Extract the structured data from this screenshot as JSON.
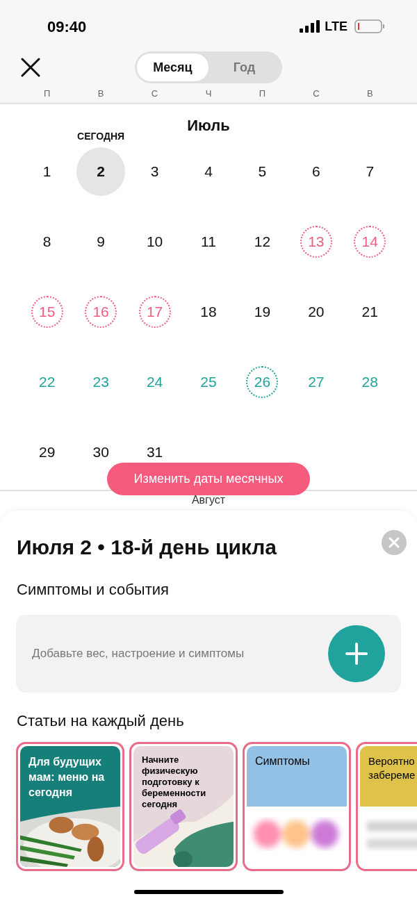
{
  "status_bar": {
    "time": "09:40",
    "network": "LTE"
  },
  "header": {
    "tabs": [
      {
        "label": "Месяц",
        "selected": true
      },
      {
        "label": "Год",
        "selected": false
      }
    ]
  },
  "weekdays": [
    "П",
    "В",
    "С",
    "Ч",
    "П",
    "С",
    "В"
  ],
  "month": {
    "title": "Июль",
    "today_label": "СЕГОДНЯ",
    "days": [
      {
        "label": "1",
        "kind": "normal"
      },
      {
        "label": "2",
        "kind": "today"
      },
      {
        "label": "3",
        "kind": "normal"
      },
      {
        "label": "4",
        "kind": "normal"
      },
      {
        "label": "5",
        "kind": "normal"
      },
      {
        "label": "6",
        "kind": "normal"
      },
      {
        "label": "7",
        "kind": "normal"
      },
      {
        "label": "8",
        "kind": "normal"
      },
      {
        "label": "9",
        "kind": "normal"
      },
      {
        "label": "10",
        "kind": "normal"
      },
      {
        "label": "11",
        "kind": "normal"
      },
      {
        "label": "12",
        "kind": "normal"
      },
      {
        "label": "13",
        "kind": "period"
      },
      {
        "label": "14",
        "kind": "period"
      },
      {
        "label": "15",
        "kind": "period"
      },
      {
        "label": "16",
        "kind": "period"
      },
      {
        "label": "17",
        "kind": "period"
      },
      {
        "label": "18",
        "kind": "normal"
      },
      {
        "label": "19",
        "kind": "normal"
      },
      {
        "label": "20",
        "kind": "normal"
      },
      {
        "label": "21",
        "kind": "normal"
      },
      {
        "label": "22",
        "kind": "fertile"
      },
      {
        "label": "23",
        "kind": "fertile"
      },
      {
        "label": "24",
        "kind": "fertile"
      },
      {
        "label": "25",
        "kind": "fertile"
      },
      {
        "label": "26",
        "kind": "ovulation"
      },
      {
        "label": "27",
        "kind": "fertile"
      },
      {
        "label": "28",
        "kind": "fertile"
      },
      {
        "label": "29",
        "kind": "normal"
      },
      {
        "label": "30",
        "kind": "normal"
      },
      {
        "label": "31",
        "kind": "normal"
      }
    ]
  },
  "edit_button": "Изменить даты месячных",
  "next_month": "Август",
  "sheet": {
    "title": "Июля 2 • 18-й день цикла",
    "symptoms_heading": "Симптомы и события",
    "symptoms_placeholder": "Добавьте вес, настроение и симптомы",
    "articles_heading": "Статьи на каждый день",
    "articles": [
      {
        "title": "Для будущих мам: меню на сегодня",
        "kind": "food"
      },
      {
        "title": "Начните физическую подготовку к беременности сегодня",
        "kind": "fitness"
      },
      {
        "title": "Симптомы",
        "kind": "symptoms"
      },
      {
        "title": "Вероятно забереме",
        "kind": "chance"
      }
    ]
  }
}
